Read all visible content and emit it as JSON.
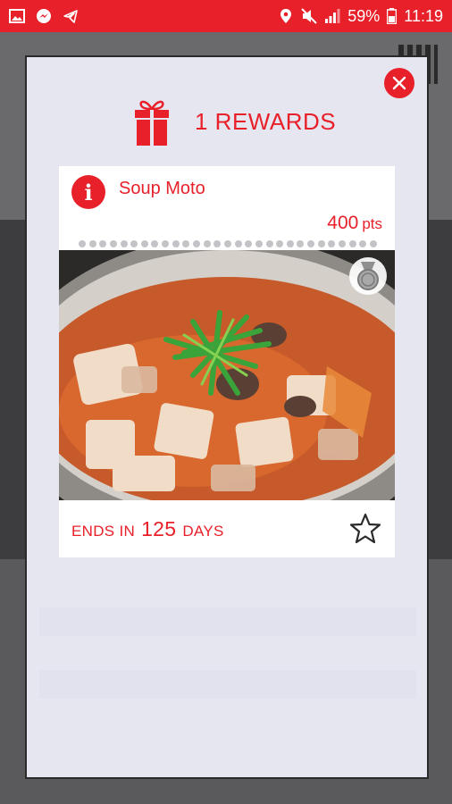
{
  "status_bar": {
    "battery": "59%",
    "time": "11:19"
  },
  "modal": {
    "rewards_count_label": "1 REWARDS",
    "close_icon": "close-icon"
  },
  "reward": {
    "name": "Soup Moto",
    "points_value": "400",
    "points_unit": "pts",
    "ends_prefix": "ENDS IN",
    "days": "125",
    "ends_suffix": "DAYS"
  },
  "colors": {
    "accent": "#e8202a",
    "modal_bg": "#e6e6f1"
  }
}
